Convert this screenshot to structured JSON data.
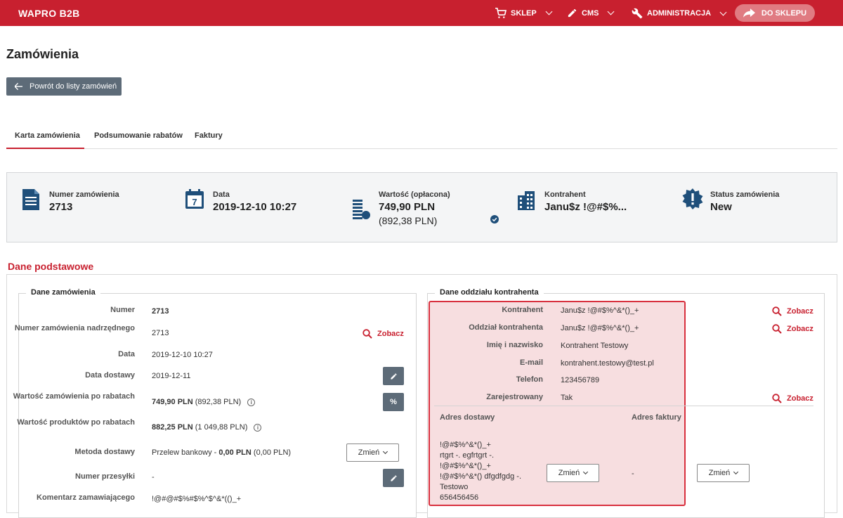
{
  "topbar": {
    "brand": "WAPRO B2B",
    "nav": [
      {
        "label": "SKLEP",
        "icon": "cart-icon"
      },
      {
        "label": "CMS",
        "icon": "pencil-icon"
      },
      {
        "label": "ADMINISTRACJA",
        "icon": "wrench-icon"
      }
    ],
    "shop_button": "DO SKLEPU"
  },
  "page": {
    "title": "Zamówienia",
    "back_button": "Powrót do listy zamówień"
  },
  "tabs": [
    {
      "label": "Karta zamówienia",
      "active": true
    },
    {
      "label": "Podsumowanie rabatów",
      "active": false
    },
    {
      "label": "Faktury",
      "active": false
    }
  ],
  "summary": {
    "order_number": {
      "label": "Numer zamówienia",
      "value": "2713"
    },
    "date": {
      "label": "Data",
      "value": "2019-12-10 10:27"
    },
    "value": {
      "label": "Wartość (opłacona)",
      "value": "749,90 PLN",
      "sub": "(892,38 PLN)"
    },
    "contractor": {
      "label": "Kontrahent",
      "value": "Janu$z !@#$%..."
    },
    "status": {
      "label": "Status zamówienia",
      "value": "New"
    }
  },
  "basic": {
    "section_title": "Dane podstawowe",
    "order_panel_title": "Dane zamówienia",
    "rows": {
      "number": {
        "label": "Numer",
        "value": "2713"
      },
      "parent_number": {
        "label": "Numer zamówienia nadrzędnego",
        "value": "2713"
      },
      "date": {
        "label": "Data",
        "value": "2019-12-10 10:27"
      },
      "delivery_date": {
        "label": "Data dostawy",
        "value": "2019-12-11"
      },
      "order_value": {
        "label": "Wartość zamówienia po rabatach",
        "value": "749,90 PLN",
        "sub": "(892,38 PLN)"
      },
      "products_value": {
        "label": "Wartość produktów po rabatach",
        "value": "882,25 PLN",
        "sub": "(1 049,88 PLN)"
      },
      "delivery_method": {
        "label": "Metoda dostawy",
        "value_prefix": "Przelew bankowy - ",
        "value_bold": "0,00 PLN",
        "value_suffix": "(0,00 PLN)"
      },
      "shipment_number": {
        "label": "Numer przesyłki",
        "value": "-"
      },
      "comment": {
        "label": "Komentarz zamawiającego",
        "value": "!@#@#$%#$%^$^&*(()_+"
      }
    },
    "zobacz_label": "Zobacz",
    "change_label": "Zmień",
    "percent_label": "%"
  },
  "branch": {
    "panel_title": "Dane oddziału kontrahenta",
    "rows": {
      "contractor": {
        "label": "Kontrahent",
        "value": "Janu$z !@#$%^&*()_+"
      },
      "branch": {
        "label": "Oddział kontrahenta",
        "value": "Janu$z !@#$%^&*()_+"
      },
      "name": {
        "label": "Imię i nazwisko",
        "value": "Kontrahent Testowy"
      },
      "email": {
        "label": "E-mail",
        "value": "kontrahent.testowy@test.pl"
      },
      "phone": {
        "label": "Telefon",
        "value": "123456789"
      },
      "registered": {
        "label": "Zarejestrowany",
        "value": "Tak"
      }
    },
    "delivery_address_title": "Adres dostawy",
    "invoice_address_title": "Adres faktury",
    "delivery_address_lines": [
      "!@#$%^&*()_+",
      "rtgrt -. egfrtgrt -.",
      "!@#$%^&*()_+",
      "!@#$%^&*() dfgdfgdg -.",
      "Testowo",
      "656456456"
    ],
    "invoice_address_value": "-"
  },
  "colors": {
    "accent": "#c8202f",
    "button_gray": "#5d6b78"
  }
}
